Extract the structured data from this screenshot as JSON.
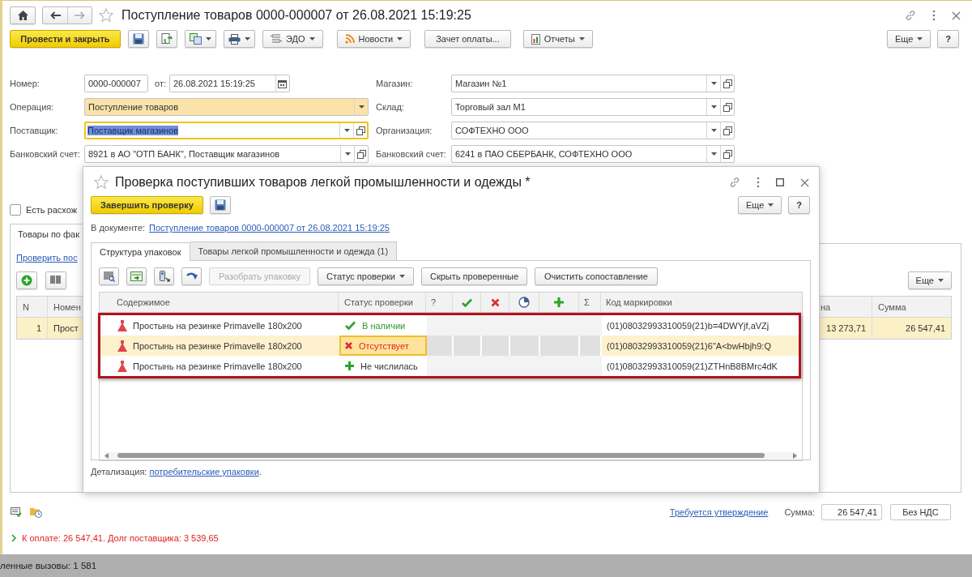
{
  "window": {
    "title": "Поступление товаров 0000-000007 от 26.08.2021 15:19:25"
  },
  "toolbar": {
    "post": "Провести и закрыть",
    "edo": "ЭДО",
    "news": "Новости",
    "offset": "Зачет оплаты...",
    "reports": "Отчеты",
    "more": "Еще",
    "help": "?"
  },
  "form": {
    "number": {
      "label": "Номер:",
      "value": "0000-000007"
    },
    "date": {
      "label": "от:",
      "value": "26.08.2021 15:19:25"
    },
    "left": [
      {
        "label": "Операция:",
        "value": "Поступление товаров",
        "kind": "select",
        "highlighted": true,
        "focused": false
      },
      {
        "label": "Поставщик:",
        "value": "Поставщик магазинов",
        "kind": "reference",
        "highlighted": false,
        "focused": true
      },
      {
        "label": "Банковский счет:",
        "value": "8921 в АО \"ОТП БАНК\", Поставщик магазинов",
        "kind": "reference",
        "highlighted": false,
        "focused": false
      }
    ],
    "right": [
      {
        "label": "Магазин:",
        "value": "Магазин №1",
        "kind": "reference",
        "highlighted": false,
        "focused": false
      },
      {
        "label": "Склад:",
        "value": "Торговый зал М1",
        "kind": "reference",
        "highlighted": false,
        "focused": false
      },
      {
        "label": "Организация:",
        "value": "СОФТЕХНО ООО",
        "kind": "reference",
        "highlighted": false,
        "focused": false
      },
      {
        "label": "Банковский счет:",
        "value": "6241 в ПАО СБЕРБАНК, СОФТЕХНО ООО",
        "kind": "reference",
        "highlighted": false,
        "focused": false
      }
    ]
  },
  "discrepancy": {
    "label": "Есть расхож",
    "checked": false
  },
  "goods": {
    "tabs": [
      {
        "label": "Товары по фак",
        "selected": true
      }
    ],
    "link": "Проверить пос",
    "more": "Еще",
    "table": {
      "columns": [
        "N",
        "Номен",
        "на",
        "Сумма"
      ],
      "rows": [
        {
          "cells": [
            "1",
            "Прост",
            "13 273,71",
            "26 547,41"
          ],
          "selected": true
        }
      ]
    }
  },
  "footer": {
    "approval": "Требуется утверждение",
    "sum_label": "Сумма:",
    "sum": "26 547,41",
    "vat": "Без НДС"
  },
  "payment": "К оплате: 26 547,41. Долг поставщика: 3 539,65",
  "status_bar": "ленные вызовы: 1 581",
  "dialog": {
    "title": "Проверка поступивших товаров легкой промышленности и одежды *",
    "finish": "Завершить проверку",
    "more": "Еще",
    "help": "?",
    "document_label": "В документе:",
    "document_link": "Поступление товаров 0000-000007 от 26.08.2021 15:19:25",
    "tabs": [
      {
        "label": "Структура упаковок",
        "selected": true
      },
      {
        "label": "Товары легкой промышленности и одежда (1)",
        "selected": false
      }
    ],
    "toolbar": {
      "unpack": {
        "label": "Разобрать упаковку",
        "disabled": true
      },
      "status": "Статус проверки",
      "hide": "Скрыть проверенные",
      "clear": "Очистить сопоставление"
    },
    "table": {
      "columns": [
        {
          "kind": "text",
          "label": "Содержимое"
        },
        {
          "kind": "text",
          "label": "Статус проверки"
        },
        {
          "kind": "text",
          "label": "?"
        },
        {
          "kind": "check"
        },
        {
          "kind": "cross"
        },
        {
          "kind": "pie"
        },
        {
          "kind": "plus"
        },
        {
          "kind": "text",
          "label": "Σ"
        },
        {
          "kind": "text",
          "label": "Код маркировки"
        }
      ],
      "rows": [
        {
          "item": "Простынь на резинке Primavelle 180x200",
          "status": {
            "kind": "present",
            "label": "В наличии"
          },
          "code": "(01)08032993310059(21)b=4DWYjf,aVZj",
          "selected": false
        },
        {
          "item": "Простынь на резинке Primavelle 180x200",
          "status": {
            "kind": "missing",
            "label": "Отсутствует"
          },
          "code": "(01)08032993310059(21)6\"A<bwHbjh9:Q",
          "selected": true
        },
        {
          "item": "Простынь на резинке Primavelle 180x200",
          "status": {
            "kind": "unlisted",
            "label": "Не числилась"
          },
          "code": "(01)08032993310059(21)ZTHnB8BMrc4dK",
          "selected": false
        }
      ]
    },
    "detail_label": "Детализация:",
    "detail_link": "потребительские упаковки",
    "detail_end": "."
  }
}
